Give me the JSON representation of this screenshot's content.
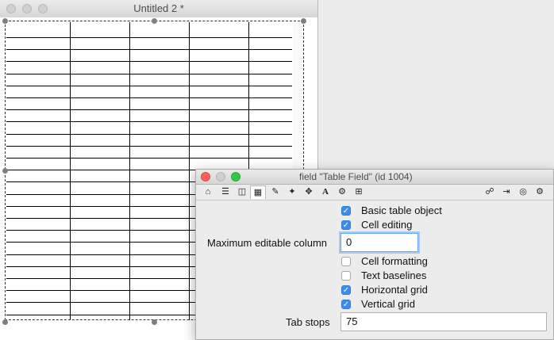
{
  "main_window": {
    "title": "Untitled 2 *"
  },
  "inspector": {
    "title": "field \"Table Field\" (id 1004)",
    "toolbar_icons": [
      "home-icon",
      "list-icon",
      "database-icon",
      "table-icon",
      "pencil-icon",
      "magic-wand-icon",
      "move-icon",
      "font-icon",
      "gears-icon",
      "arrows-box-icon",
      "lock-open-icon",
      "login-icon",
      "target-icon",
      "gear-icon"
    ],
    "options": {
      "basic_table_object": {
        "label": "Basic table object",
        "checked": true
      },
      "cell_editing": {
        "label": "Cell editing",
        "checked": true
      },
      "cell_formatting": {
        "label": "Cell formatting",
        "checked": false
      },
      "text_baselines": {
        "label": "Text baselines",
        "checked": false
      },
      "horizontal_grid": {
        "label": "Horizontal grid",
        "checked": true
      },
      "vertical_grid": {
        "label": "Vertical grid",
        "checked": true
      }
    },
    "max_editable_column": {
      "label": "Maximum editable column",
      "value": "0"
    },
    "tab_stops": {
      "label": "Tab stops",
      "value": "75"
    }
  },
  "colors": {
    "checkbox_on": "#3b8ced",
    "close": "#fc605c",
    "zoom": "#34c84a"
  }
}
